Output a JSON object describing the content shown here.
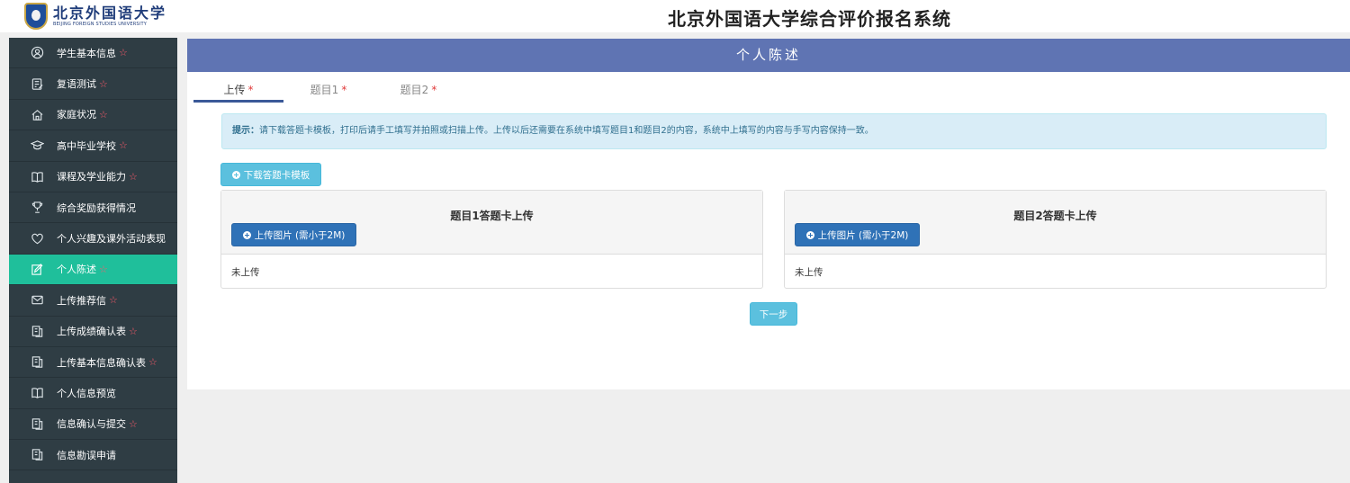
{
  "header": {
    "logo_cn": "北京外国语大学",
    "logo_en": "BEIJING FOREIGN STUDIES UNIVERSITY",
    "app_title": "北京外国语大学综合评价报名系统"
  },
  "sidebar": {
    "items": [
      {
        "label": "学生基本信息",
        "star": "☆",
        "icon": "user-circle-icon"
      },
      {
        "label": "复语测试",
        "star": "☆",
        "icon": "edit-document-icon"
      },
      {
        "label": "家庭状况",
        "star": "☆",
        "icon": "home-icon"
      },
      {
        "label": "高中毕业学校",
        "star": "☆",
        "icon": "graduation-cap-icon"
      },
      {
        "label": "课程及学业能力",
        "star": "☆",
        "icon": "book-icon"
      },
      {
        "label": "综合奖励获得情况",
        "star": "",
        "icon": "trophy-icon"
      },
      {
        "label": "个人兴趣及课外活动表现",
        "star": "",
        "icon": "heart-icon"
      },
      {
        "label": "个人陈述",
        "star": "☆",
        "icon": "pencil-square-icon"
      },
      {
        "label": "上传推荐信",
        "star": "☆",
        "icon": "envelope-icon"
      },
      {
        "label": "上传成绩确认表",
        "star": "☆",
        "icon": "file-copy-icon"
      },
      {
        "label": "上传基本信息确认表",
        "star": "☆",
        "icon": "file-copy-icon"
      },
      {
        "label": "个人信息预览",
        "star": "",
        "icon": "book-icon"
      },
      {
        "label": "信息确认与提交",
        "star": "☆",
        "icon": "file-copy-icon"
      },
      {
        "label": "信息勘误申请",
        "star": "",
        "icon": "file-copy-icon"
      }
    ],
    "active_index": 7
  },
  "main": {
    "title": "个人陈述",
    "tabs": [
      {
        "label": "上传",
        "req": "*"
      },
      {
        "label": "题目1",
        "req": "*"
      },
      {
        "label": "题目2",
        "req": "*"
      }
    ],
    "tip_prefix": "提示：",
    "tip_text": "请下载答题卡模板，打印后请手工填写并拍照或扫描上传。上传以后还需要在系统中填写题目1和题目2的内容，系统中上填写的内容与手写内容保持一致。",
    "download_label": "下载答题卡模板",
    "panels": [
      {
        "title": "题目1答题卡上传",
        "upload_label": "上传图片 (需小于2M)",
        "status": "未上传"
      },
      {
        "title": "题目2答题卡上传",
        "upload_label": "上传图片 (需小于2M)",
        "status": "未上传"
      }
    ],
    "next_label": "下一步"
  },
  "colors": {
    "sidebar_bg": "#2f3d44",
    "active_item": "#1fbf9b",
    "header_bar": "#5f74b3",
    "info_button": "#5bc0de",
    "primary_button": "#2f72b7"
  }
}
